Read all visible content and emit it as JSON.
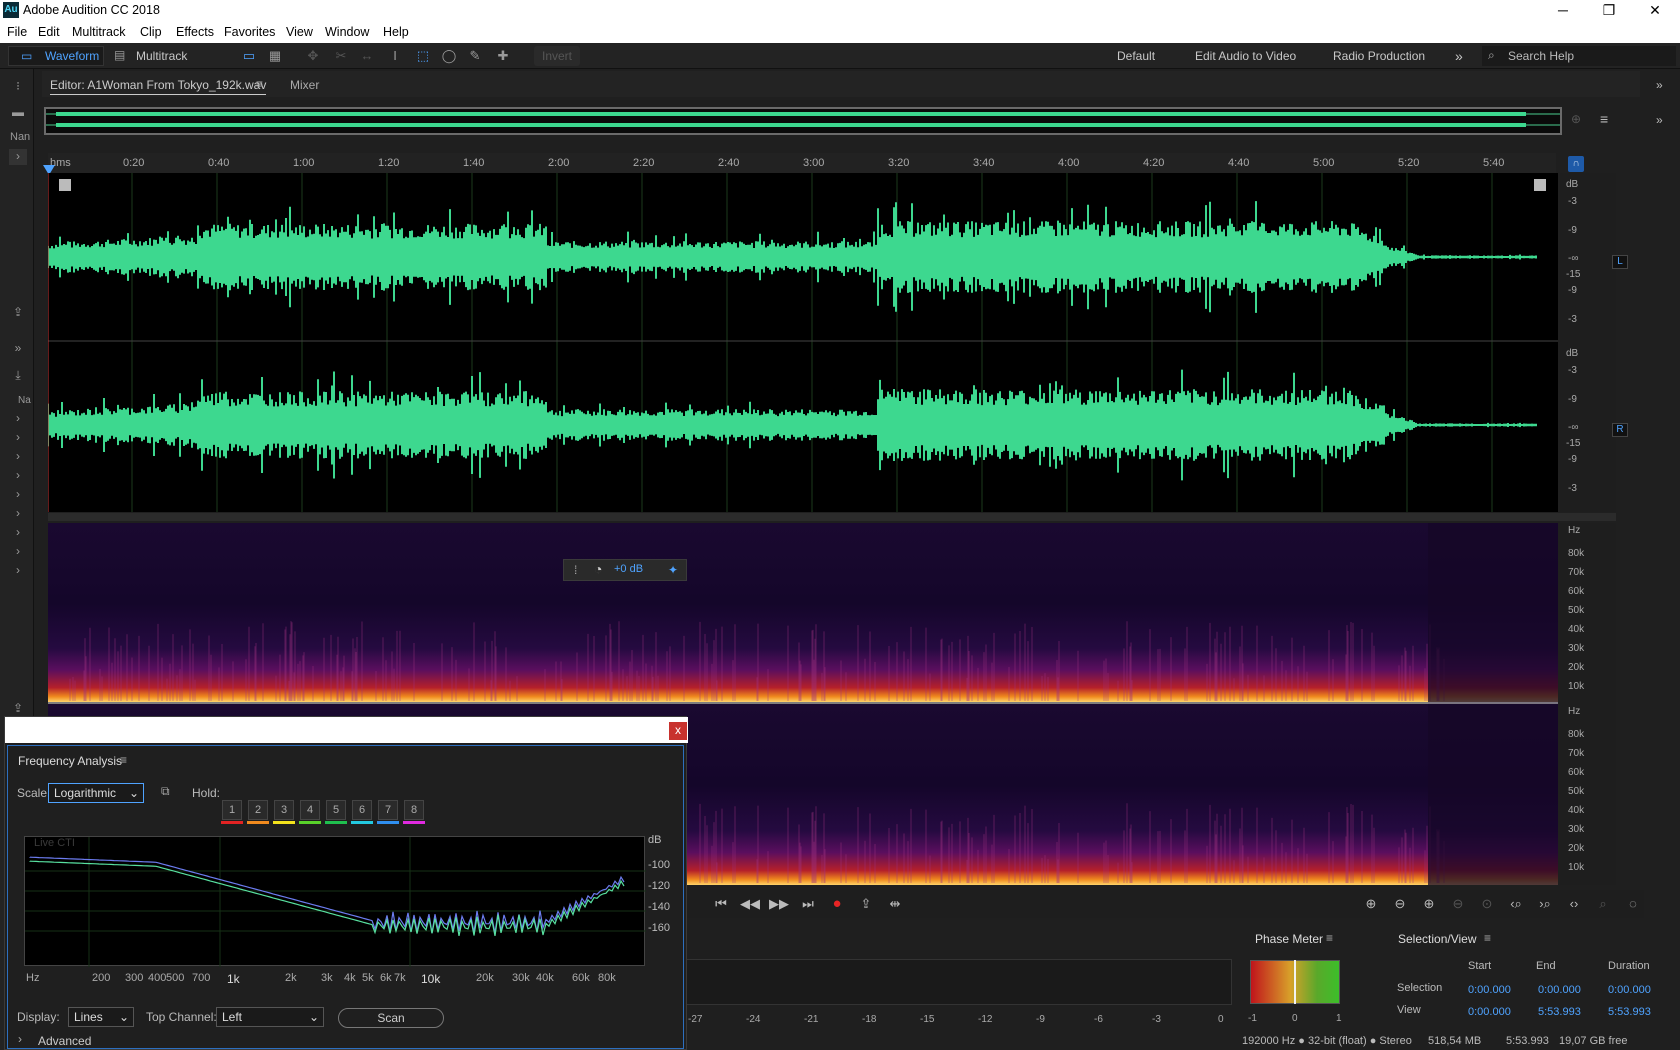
{
  "app": {
    "title": "Adobe Audition CC 2018",
    "logo": "Au"
  },
  "window_controls": {
    "minimize": "─",
    "maximize": "❐",
    "close": "✕"
  },
  "menu": [
    "File",
    "Edit",
    "Multitrack",
    "Clip",
    "Effects",
    "Favorites",
    "View",
    "Window",
    "Help"
  ],
  "toolbar": {
    "waveform": "Waveform",
    "multitrack": "Multitrack",
    "invert": "Invert",
    "workspaces": [
      "Default",
      "Edit Audio to Video",
      "Radio Production"
    ],
    "more": "»",
    "search_placeholder": "Search Help"
  },
  "left_panel": {
    "name_label": "Nan",
    "name_label2": "Na"
  },
  "editor": {
    "tab": "Editor: A1Woman From Tokyo_192k.wav",
    "menu_icon": "≡",
    "mixer": "Mixer"
  },
  "ruler": {
    "labels": [
      "hms",
      "0:20",
      "0:40",
      "1:00",
      "1:20",
      "1:40",
      "2:00",
      "2:20",
      "2:40",
      "3:00",
      "3:20",
      "3:40",
      "4:00",
      "4:20",
      "4:40",
      "5:00",
      "5:20",
      "5:40"
    ]
  },
  "db_scale": {
    "ticks": [
      "dB",
      "-3",
      "-9",
      "-∞",
      "-15",
      "-9",
      "-3"
    ],
    "left_badge": "L",
    "right_badge": "R"
  },
  "hud": {
    "value": "+0 dB"
  },
  "hz_scale": {
    "ticks": [
      "Hz",
      "80k",
      "70k",
      "60k",
      "50k",
      "40k",
      "30k",
      "20k",
      "10k"
    ]
  },
  "transport": {
    "buttons": [
      "to-start",
      "rewind",
      "fast-forward",
      "to-end",
      "record",
      "loop",
      "skip"
    ]
  },
  "meter_scale": [
    "-27",
    "-24",
    "-21",
    "-18",
    "-15",
    "-12",
    "-9",
    "-6",
    "-3",
    "0"
  ],
  "phase_meter": {
    "title": "Phase Meter",
    "scale": [
      "-1",
      "0",
      "1"
    ]
  },
  "selection_view": {
    "title": "Selection/View",
    "columns": [
      "Start",
      "End",
      "Duration"
    ],
    "rows": [
      {
        "label": "Selection",
        "start": "0:00.000",
        "end": "0:00.000",
        "duration": "0:00.000"
      },
      {
        "label": "View",
        "start": "0:00.000",
        "end": "5:53.993",
        "duration": "5:53.993"
      }
    ]
  },
  "status": {
    "format": "192000 Hz ● 32-bit (float) ● Stereo",
    "size": "518,54 MB",
    "duration": "5:53.993",
    "free": "19,07 GB free"
  },
  "frequency_analysis": {
    "title": "Frequency Analysis",
    "scale_label": "Scale:",
    "scale_value": "Logarithmic",
    "hold_label": "Hold:",
    "hold_buttons": [
      "1",
      "2",
      "3",
      "4",
      "5",
      "6",
      "7",
      "8"
    ],
    "hold_colors": [
      "#e22323",
      "#f08a1e",
      "#f2e11c",
      "#59d12a",
      "#1fbf4e",
      "#23c9e0",
      "#2f8ff0",
      "#e02ae0"
    ],
    "live_label": "Live CTI",
    "db_axis": {
      "title": "dB",
      "ticks": [
        "-100",
        "-120",
        "-140",
        "-160"
      ]
    },
    "hz_axis": [
      "Hz",
      "200",
      "300",
      "400",
      "500",
      "700",
      "1k",
      "2k",
      "3k",
      "4k",
      "5k",
      "6k",
      "7k",
      "10k",
      "20k",
      "30k",
      "40k",
      "60k",
      "80k"
    ],
    "display_label": "Display:",
    "display_value": "Lines",
    "top_channel_label": "Top Channel:",
    "top_channel_value": "Left",
    "scan": "Scan",
    "advanced": "Advanced"
  },
  "colors": {
    "waveform": "#3dd88f",
    "accent": "#4fa3ff",
    "record": "#e82525"
  }
}
